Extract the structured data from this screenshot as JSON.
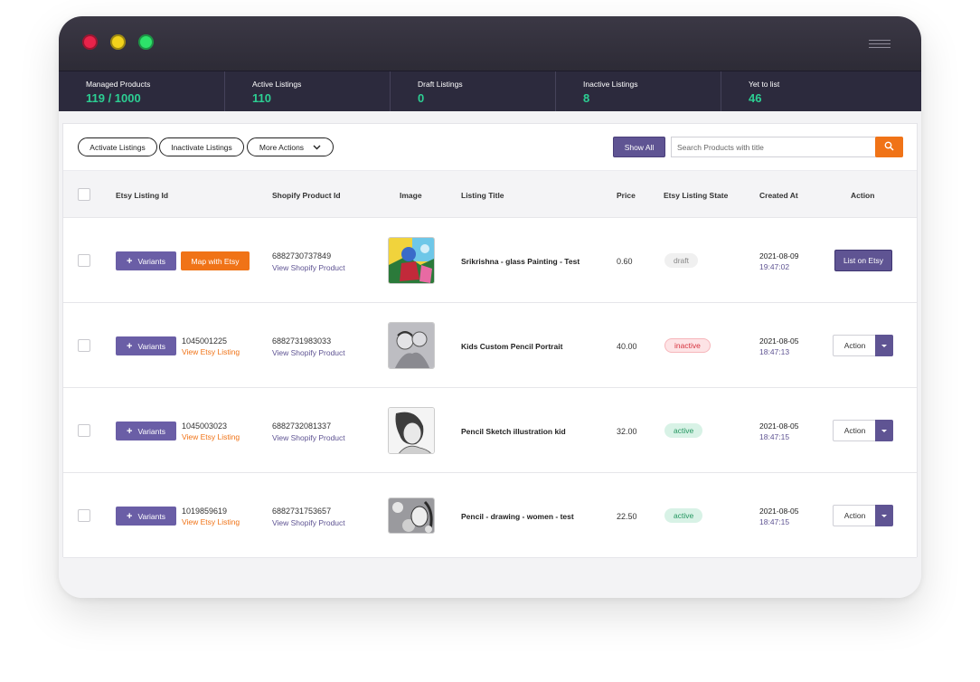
{
  "stats": [
    {
      "label": "Managed Products",
      "value": "119 / 1000"
    },
    {
      "label": "Active Listings",
      "value": "110"
    },
    {
      "label": "Draft Listings",
      "value": "0"
    },
    {
      "label": "Inactive Listings",
      "value": "8"
    },
    {
      "label": "Yet to list",
      "value": "46"
    }
  ],
  "toolbar": {
    "activate": "Activate Listings",
    "inactivate": "Inactivate Listings",
    "more": "More Actions",
    "show_all": "Show All",
    "search_placeholder": "Search Products with title"
  },
  "columns": [
    "Etsy Listing Id",
    "Shopify Product Id",
    "Image",
    "Listing Title",
    "Price",
    "Etsy Listing State",
    "Created At",
    "Action"
  ],
  "rows": [
    {
      "variants_label": "Variants",
      "map_label": "Map with Etsy",
      "etsy_id": "",
      "etsy_link": "",
      "shopify_id": "6882730737849",
      "shopify_link": "View Shopify Product",
      "title": "Srikrishna - glass Painting - Test",
      "price": "0.60",
      "state": "draft",
      "date": "2021-08-09",
      "time": "19:47:02",
      "action": "List on Etsy"
    },
    {
      "variants_label": "Variants",
      "etsy_id": "1045001225",
      "etsy_link": "View Etsy Listing",
      "shopify_id": "6882731983033",
      "shopify_link": "View Shopify Product",
      "title": "Kids Custom Pencil Portrait",
      "price": "40.00",
      "state": "inactive",
      "date": "2021-08-05",
      "time": "18:47:13",
      "action": "Action"
    },
    {
      "variants_label": "Variants",
      "etsy_id": "1045003023",
      "etsy_link": "View Etsy Listing",
      "shopify_id": "6882732081337",
      "shopify_link": "View Shopify Product",
      "title": "Pencil Sketch illustration kid",
      "price": "32.00",
      "state": "active",
      "date": "2021-08-05",
      "time": "18:47:15",
      "action": "Action"
    },
    {
      "variants_label": "Variants",
      "etsy_id": "1019859619",
      "etsy_link": "View Etsy Listing",
      "shopify_id": "6882731753657",
      "shopify_link": "View Shopify Product",
      "title": "Pencil - drawing - women - test",
      "price": "22.50",
      "state": "active",
      "date": "2021-08-05",
      "time": "18:47:15",
      "action": "Action"
    }
  ],
  "colors": {
    "primary": "#5f5493",
    "accent": "#f07317",
    "stat_value": "#2ccf93",
    "titlebar": "#2c2a3d"
  }
}
